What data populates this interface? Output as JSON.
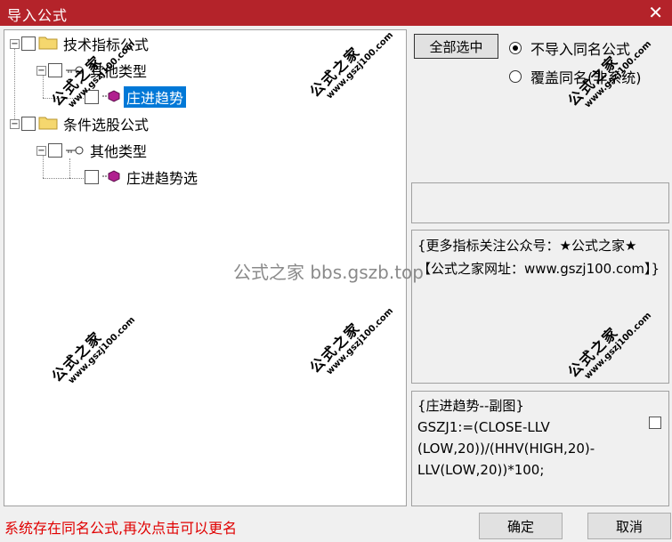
{
  "window": {
    "title": "导入公式",
    "close": "✕"
  },
  "tree": {
    "groups": [
      {
        "label": "技术指标公式",
        "subgroup": {
          "label": "其他类型",
          "items": [
            "庄进趋势"
          ]
        }
      },
      {
        "label": "条件选股公式",
        "subgroup": {
          "label": "其他类型",
          "items": [
            "庄进趋势选"
          ]
        }
      }
    ],
    "selected": "庄进趋势"
  },
  "buttons": {
    "select_all": "全部选中",
    "ok": "确定",
    "cancel": "取消"
  },
  "options": [
    {
      "label": "不导入同名公式",
      "checked": true
    },
    {
      "label": "覆盖同名(非系统)",
      "checked": false
    }
  ],
  "description": "{更多指标关注公众号：★公式之家★ 【公式之家网址：www.gszj100.com】}",
  "code_lines": [
    "{庄进趋势--副图}",
    "GSZJ1:=(CLOSE-LLV",
    "(LOW,20))/(HHV(HIGH,20)-",
    "LLV(LOW,20))*100;"
  ],
  "status": "系统存在同名公式,再次点击可以更名",
  "watermark": {
    "cn": "公式之家",
    "url": "www.gszj100.com",
    "center": "公式之家 bbs.gszb.top"
  }
}
